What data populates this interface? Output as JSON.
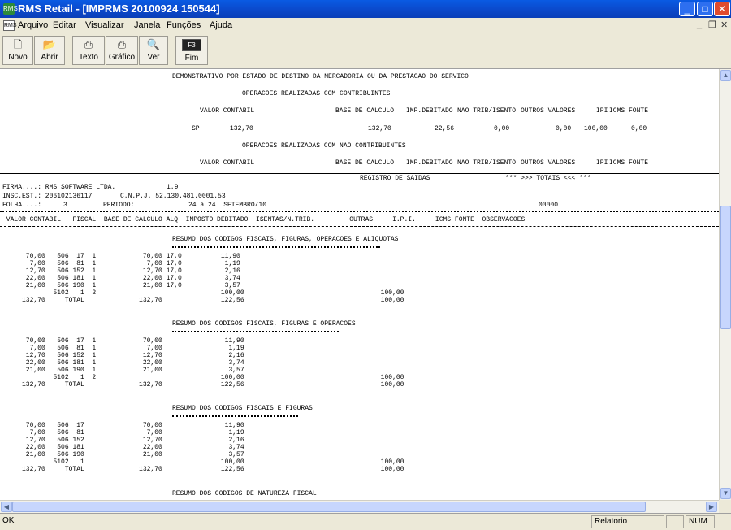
{
  "window": {
    "title": "RMS Retail - [IMPRMS 20100924 150544]",
    "app_icon": "RMS",
    "minimize": "_",
    "maximize": "□",
    "close": "✕"
  },
  "menu": {
    "doc_icon": "RMS",
    "items": [
      "Arquivo",
      "Editar",
      "Visualizar",
      "Janela",
      "Funções",
      "Ajuda"
    ],
    "mdi_min": "_",
    "mdi_restore": "❐",
    "mdi_close": "✕"
  },
  "toolbar": {
    "buttons": [
      {
        "label": "Novo",
        "icon": "new-file-icon"
      },
      {
        "label": "Abrir",
        "icon": "open-folder-icon"
      },
      {
        "label": "Texto",
        "icon": "printer-icon"
      },
      {
        "label": "Gráfico",
        "icon": "printer-graph-icon"
      },
      {
        "label": "Ver",
        "icon": "preview-icon"
      },
      {
        "label": "Fim",
        "icon": "f3-key-icon",
        "key": "F3"
      }
    ]
  },
  "report": {
    "header": "DEMONSTRATIVO POR ESTADO DE DESTINO DA MERCADORIA OU DA PRESTACAO DO SERVICO",
    "section_contrib": "OPERACOES REALIZADAS COM CONTRIBUINTES",
    "cols": {
      "valor": "VALOR CONTABIL",
      "base": "BASE DE CALCULO",
      "imp": "IMP.DEBITADO",
      "nao": "NAO TRIB/ISENTO",
      "outros": "OUTROS VALORES",
      "ipi": "IPI",
      "icms": "ICMS FONTE"
    },
    "sp_row": {
      "uf": "SP",
      "valor": "132,70",
      "base": "132,70",
      "imp": "22,56",
      "nao": "0,00",
      "outros": "0,00",
      "ipi": "100,00",
      "icms": "0,00"
    },
    "section_nao": "OPERACOES REALIZADAS COM NAO CONTRIBUINTES",
    "registro": "REGISTRO DE SAIDAS",
    "totais": "*** >>> TOTAIS <<< ***",
    "firma": "FIRMA....: RMS SOFTWARE LTDA.",
    "version": "1.9",
    "insc": "INSC.EST.: 206102136117",
    "cnpj": "C.N.P.J. 52.130.481.0001.53",
    "folha": "FOLHA....:",
    "folha_num": "3",
    "periodo": "PERIODO:",
    "periodo_val": "24 a 24  SETEMBRO/10",
    "code": "00000",
    "colhdr": " VALOR CONTABIL   FISCAL  BASE DE CALCULO ALQ  IMPOSTO DEBITADO  ISENTAS/N.TRIB.         OUTRAS     I.P.I.     ICMS FONTE  OBSERVACOES",
    "sec1": "RESUMO DOS CODIGOS FISCAIS, FIGURAS, OPERACOES E ALIQUOTAS",
    "sec1_lines": [
      "      70,00   506  17  1            70,00 17,0          11,90",
      "       7,00   506  81  1             7,00 17,0           1,19",
      "      12,70   506 152  1            12,70 17,0           2,16",
      "      22,00   506 181  1            22,00 17,0           3,74",
      "      21,00   506 190  1            21,00 17,0           3,57",
      "             5102   1  2                                100,00                                   100,00",
      "     132,70     TOTAL              132,70               122,56                                   100,00"
    ],
    "sec2": "RESUMO DOS CODIGOS FISCAIS, FIGURAS E OPERACOES",
    "sec2_lines": [
      "      70,00   506  17  1            70,00                11,90",
      "       7,00   506  81  1             7,00                 1,19",
      "      12,70   506 152  1            12,70                 2,16",
      "      22,00   506 181  1            22,00                 3,74",
      "      21,00   506 190  1            21,00                 3,57",
      "             5102   1  2                                100,00                                   100,00",
      "     132,70     TOTAL              132,70               122,56                                   100,00"
    ],
    "sec3": "RESUMO DOS CODIGOS FISCAIS E FIGURAS",
    "sec3_lines": [
      "      70,00   506  17               70,00                11,90",
      "       7,00   506  81                7,00                 1,19",
      "      12,70   506 152               12,70                 2,16",
      "      22,00   506 181               22,00                 3,74",
      "      21,00   506 190               21,00                 3,57",
      "             5102   1                                   100,00                                   100,00",
      "     132,70     TOTAL              132,70               122,56                                   100,00"
    ],
    "sec4": "RESUMO DOS CODIGOS DE NATUREZA FISCAL"
  },
  "status": {
    "left": "OK",
    "mode": "Relatorio",
    "num": "NUM"
  }
}
